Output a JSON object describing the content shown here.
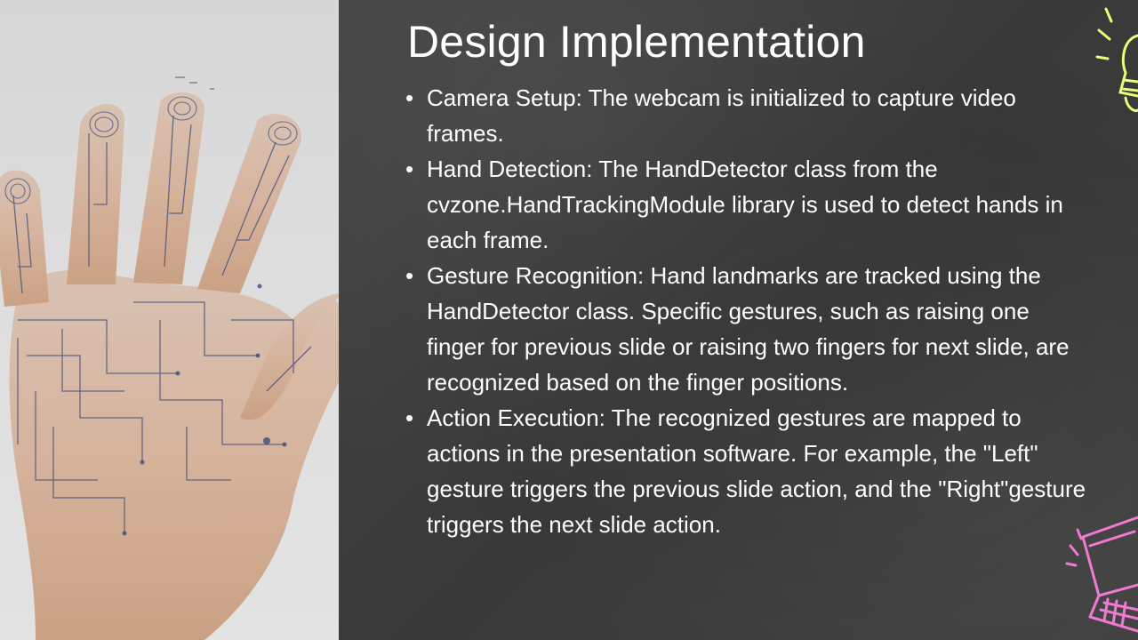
{
  "slide": {
    "title": "Design Implementation",
    "bullets": [
      "Camera Setup: The webcam is initialized to capture video frames.",
      "Hand Detection: The HandDetector class from the cvzone.HandTrackingModule library is used to detect hands in each frame.",
      "Gesture Recognition: Hand landmarks are tracked using the HandDetector class. Specific gestures, such as raising one finger for previous slide or raising two fingers for next slide, are recognized based on the finger positions.",
      " Action Execution: The recognized gestures are mapped to actions in the presentation software. For example, the \"Left\" gesture triggers the previous slide action, and the \"Right\"gesture triggers the next slide action."
    ]
  },
  "images": {
    "left_photo": "circuit-hand-image",
    "top_right_doodle": "lightbulb-doodle-icon",
    "bottom_right_doodle": "laptop-doodle-icon"
  },
  "colors": {
    "board": "#3b3b3c",
    "text": "#ffffff",
    "bulb": "#e8ff78",
    "laptop": "#f07ad0"
  }
}
